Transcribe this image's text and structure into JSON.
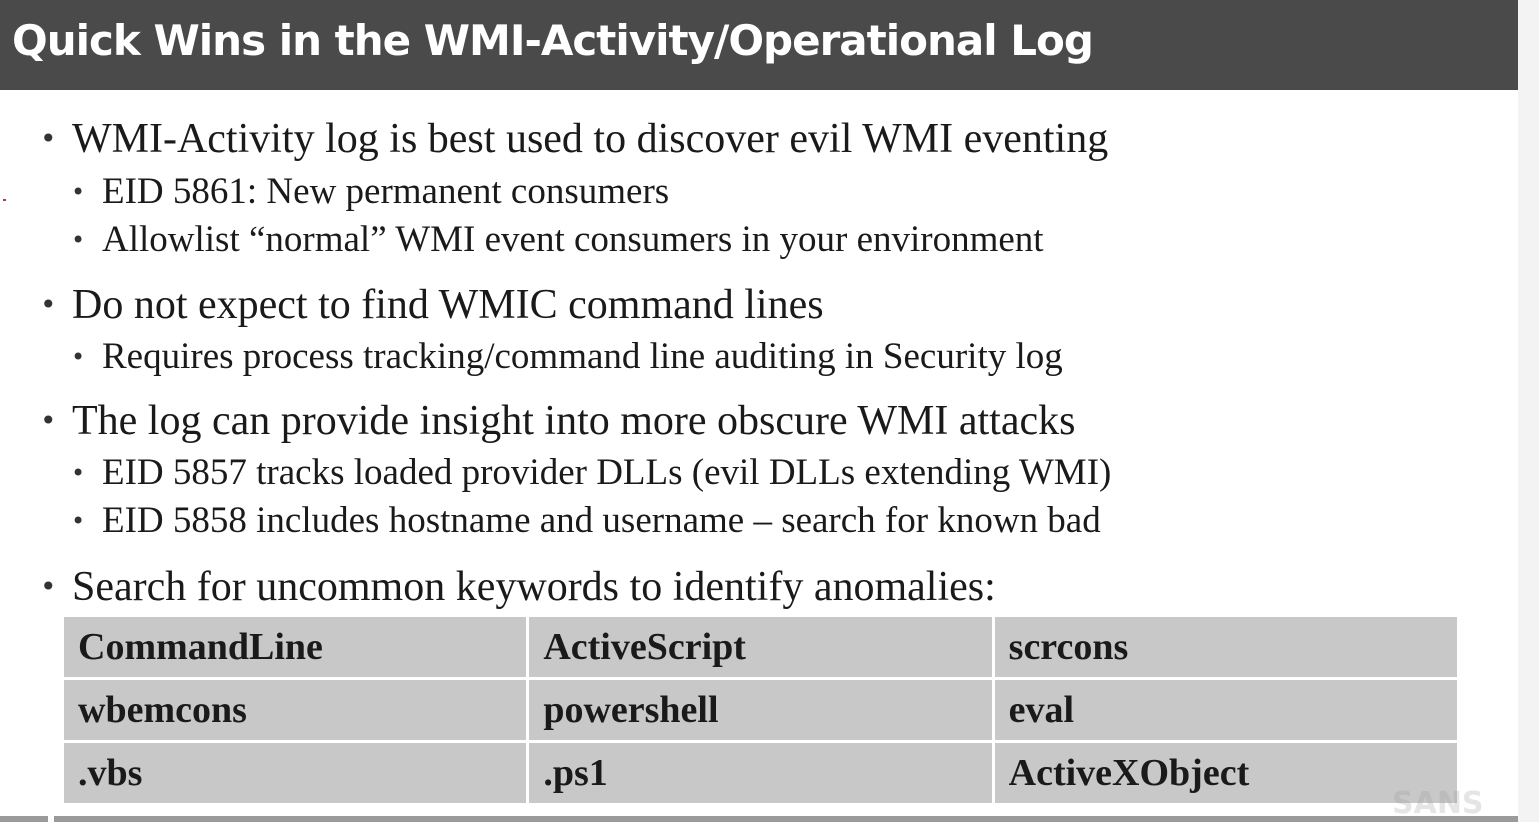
{
  "title": "Quick Wins in the WMI-Activity/Operational Log",
  "bullets": [
    {
      "text": "WMI-Activity log is best used to discover evil WMI eventing",
      "sub": [
        "EID 5861: New permanent consumers",
        "Allowlist “normal” WMI event consumers in your environment"
      ]
    },
    {
      "text": "Do not expect to find WMIC command lines",
      "sub": [
        "Requires process tracking/command line auditing in Security log"
      ]
    },
    {
      "text": "The log can provide insight into more obscure WMI attacks",
      "sub": [
        "EID 5857 tracks loaded provider DLLs (evil DLLs extending WMI)",
        "EID 5858 includes hostname and username – search for known bad"
      ]
    },
    {
      "text": "Search for uncommon keywords to identify anomalies:",
      "sub": []
    }
  ],
  "keywords": [
    [
      "CommandLine",
      "ActiveScript",
      "scrcons"
    ],
    [
      "wbemcons",
      "powershell",
      "eval"
    ],
    [
      ".vbs",
      ".ps1",
      "ActiveXObject"
    ]
  ],
  "watermark": "SANS",
  "colors": {
    "title_bar": "#4a4a4a",
    "title_text": "#ffffff",
    "table_cell": "#c8c8c8",
    "body_text": "#1a1a1a"
  }
}
